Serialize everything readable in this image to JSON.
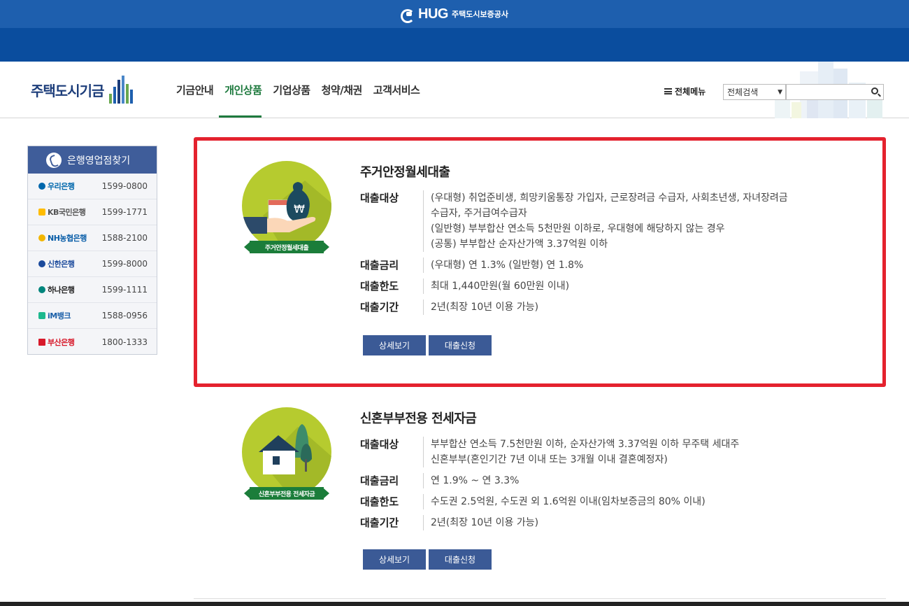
{
  "brand": {
    "hug_logo_text": "HUG",
    "hug_logo_sub": "주택도시보증공사",
    "site_name": "주택도시기금"
  },
  "nav": {
    "items": [
      "기금안내",
      "개인상품",
      "기업상품",
      "청약/채권",
      "고객서비스"
    ],
    "active": "개인상품",
    "all_menu": "전체메뉴",
    "search_scope": "전체검색",
    "search_value": ""
  },
  "colors": {
    "top_blue": "#1e5fae",
    "band_blue": "#0a4d9e",
    "accent_green": "#1e7a3e",
    "highlight_red": "#e4222e",
    "button_blue": "#3b5a96",
    "badge_lime": "#b6cb2f"
  },
  "bank_finder": {
    "title": "은행영업점찾기",
    "banks": [
      {
        "name": "우리은행",
        "tel": "1599-0800",
        "color": "#0067ac"
      },
      {
        "name": "KB국민은행",
        "tel": "1599-1771",
        "color": "#ffbc00"
      },
      {
        "name": "NH농협은행",
        "tel": "1588-2100",
        "color": "#0a5ea8"
      },
      {
        "name": "신한은행",
        "tel": "1599-8000",
        "color": "#1b4a9c"
      },
      {
        "name": "하나은행",
        "tel": "1599-1111",
        "color": "#00857c"
      },
      {
        "name": "iM뱅크",
        "tel": "1588-0956",
        "color": "#1db88e"
      },
      {
        "name": "부산은행",
        "tel": "1800-1333",
        "color": "#d7192a"
      }
    ]
  },
  "products": [
    {
      "title": "주거안정월세대출",
      "badge": "주거안정월세대출",
      "icon": "money-bag-hand-icon",
      "target_label": "대출대상",
      "target_lines": [
        "(우대형) 취업준비생, 희망키움통장 가입자, 근로장려금 수급자, 사회초년생, 자녀장려금",
        "수급자, 주거급여수급자",
        "(일반형) 부부합산 연소득 5천만원 이하로, 우대형에 해당하지 않는 경우",
        "(공통) 부부합산 순자산가액 3.37억원 이하"
      ],
      "rate_label": "대출금리",
      "rate": "(우대형) 연 1.3% (일반형) 연 1.8%",
      "limit_label": "대출한도",
      "limit": "최대 1,440만원(월 60만원 이내)",
      "period_label": "대출기간",
      "period": "2년(최장 10년 이용 가능)",
      "detail_button": "상세보기",
      "apply_button": "대출신청"
    },
    {
      "title": "신혼부부전용 전세자금",
      "badge": "신혼부부전용 전세자금",
      "icon": "house-trees-icon",
      "target_label": "대출대상",
      "target_lines": [
        "부부합산 연소득 7.5천만원 이하, 순자산가액 3.37억원 이하 무주택 세대주",
        "신혼부부(혼인기간 7년 이내 또는 3개월 이내 결혼예정자)"
      ],
      "rate_label": "대출금리",
      "rate": "연 1.9% ~ 연 3.3%",
      "limit_label": "대출한도",
      "limit": "수도권 2.5억원, 수도권 외 1.6억원 이내(임차보증금의 80% 이내)",
      "period_label": "대출기간",
      "period": "2년(최장 10년 이용 가능)",
      "detail_button": "상세보기",
      "apply_button": "대출신청"
    }
  ]
}
